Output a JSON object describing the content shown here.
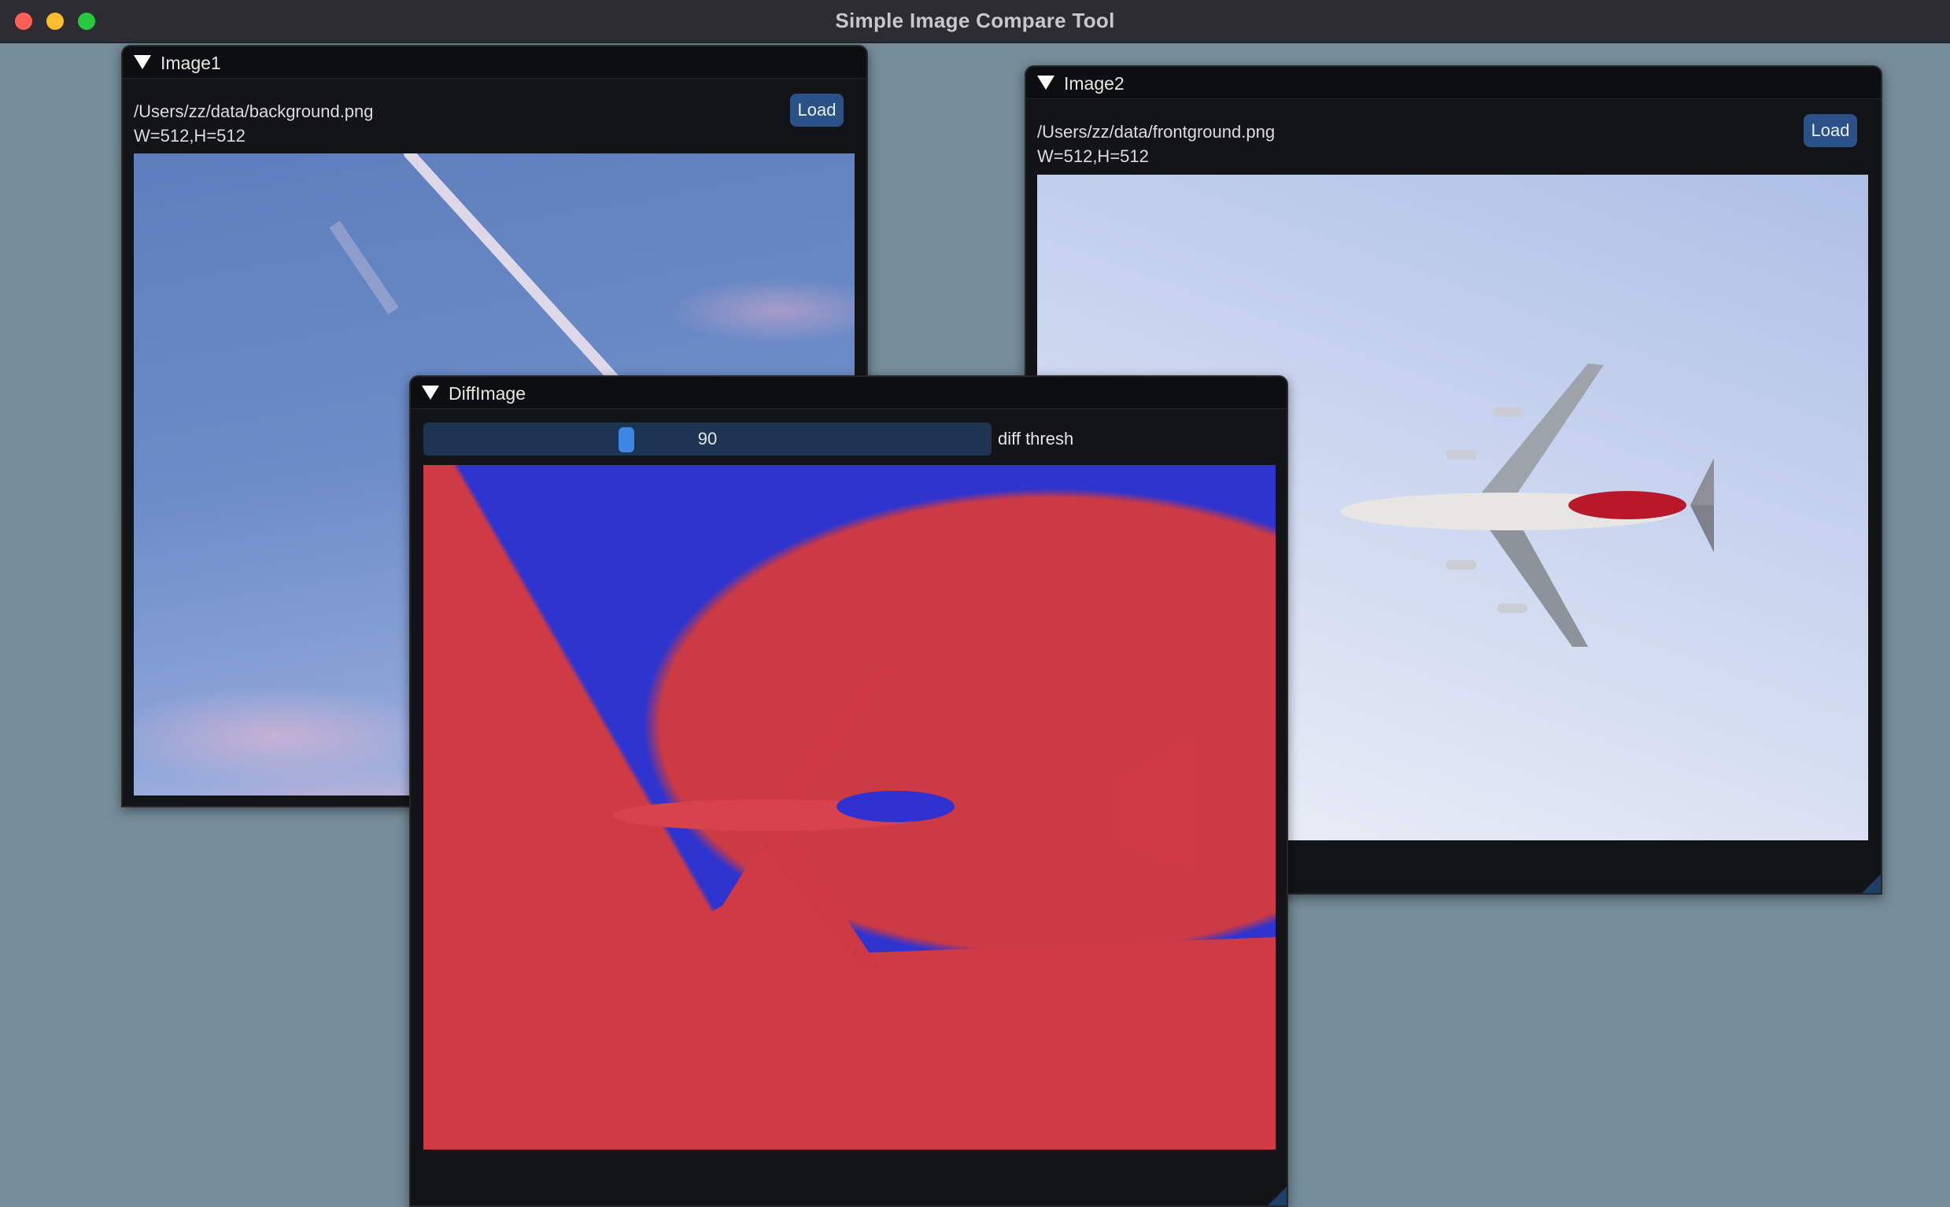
{
  "app": {
    "title": "Simple Image Compare Tool"
  },
  "windows": {
    "image1": {
      "title": "Image1",
      "path": "/Users/zz/data/background.png",
      "size": "W=512,H=512",
      "load_label": "Load"
    },
    "image2": {
      "title": "Image2",
      "path": "/Users/zz/data/frontground.png",
      "size": "W=512,H=512",
      "load_label": "Load"
    },
    "diff": {
      "title": "DiffImage",
      "slider_value": "90",
      "slider_label": "diff thresh"
    }
  },
  "icons": {
    "collapse": "triangle-down-icon"
  },
  "colors": {
    "desktop": "#758c99",
    "window_bg": "#131417",
    "button": "#2a5188",
    "slider_track": "#1d3452",
    "slider_grab": "#3d86e3",
    "diff_match": "#2f34cf",
    "diff_mismatch": "#cf3b45"
  }
}
